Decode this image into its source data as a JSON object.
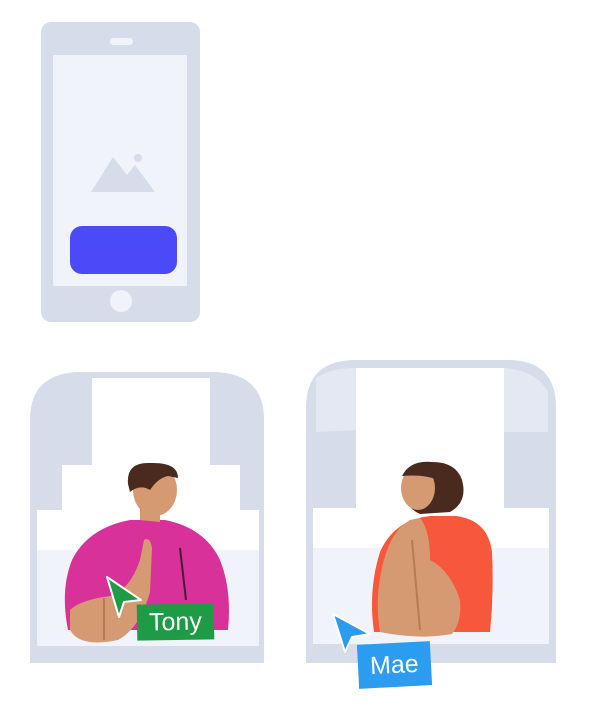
{
  "colors": {
    "frame": "#d7dcea",
    "screen": "#f0f4fa",
    "primary_button": "#4b4af8",
    "tony_tag": "#1e9c45",
    "tony_cursor": "#1e9c45",
    "mae_tag": "#2b9cf0",
    "mae_cursor": "#2b9cf0",
    "tony_shirt": "#d8329a",
    "mae_shirt": "#f7583b",
    "skin": "#d69a72",
    "hair": "#4a2a1e"
  },
  "icons": {
    "phone": "phone-mockup-icon",
    "image_placeholder": "image-placeholder-icon",
    "tony_cursor": "cursor-arrow-icon",
    "mae_cursor": "cursor-arrow-icon"
  },
  "participants": [
    {
      "name": "Tony"
    },
    {
      "name": "Mae"
    }
  ]
}
